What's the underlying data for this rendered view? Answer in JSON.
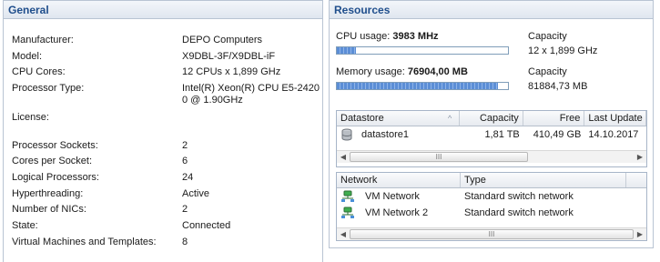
{
  "general": {
    "title": "General",
    "rows": [
      {
        "label": "Manufacturer:",
        "value": "DEPO Computers"
      },
      {
        "label": "Model:",
        "value": "X9DBL-3F/X9DBL-iF"
      },
      {
        "label": "CPU Cores:",
        "value": "12 CPUs x 1,899 GHz"
      },
      {
        "label": "Processor Type:",
        "value": "Intel(R) Xeon(R) CPU E5-2420",
        "value2": "0 @ 1.90GHz"
      },
      {
        "label": "License:",
        "value": ""
      },
      {
        "label": "Processor Sockets:",
        "value": "2"
      },
      {
        "label": "Cores per Socket:",
        "value": "6"
      },
      {
        "label": "Logical Processors:",
        "value": "24"
      },
      {
        "label": "Hyperthreading:",
        "value": "Active"
      },
      {
        "label": "Number of NICs:",
        "value": "2"
      },
      {
        "label": "State:",
        "value": "Connected"
      },
      {
        "label": "Virtual Machines and Templates:",
        "value": "8"
      }
    ]
  },
  "resources": {
    "title": "Resources",
    "cpu": {
      "label": "CPU usage:",
      "value": "3983 MHz",
      "capacity_label": "Capacity",
      "capacity": "12 x 1,899 GHz",
      "fill": 0.11
    },
    "memory": {
      "label": "Memory usage:",
      "value": "76904,00 MB",
      "capacity_label": "Capacity",
      "capacity": "81884,73 MB",
      "fill": 0.94
    },
    "datastore_table": {
      "columns": [
        "Datastore",
        "Capacity",
        "Free",
        "Last Update"
      ],
      "rows": [
        {
          "name": "datastore1",
          "capacity": "1,81 TB",
          "free": "410,49 GB",
          "last_update": "14.10.2017"
        }
      ]
    },
    "network_table": {
      "columns": [
        "Network",
        "Type"
      ],
      "rows": [
        {
          "name": "VM Network",
          "type": "Standard switch network"
        },
        {
          "name": "VM Network 2",
          "type": "Standard switch network"
        }
      ]
    }
  },
  "icons": {
    "scroll_thumb_grip": "III",
    "sort_arrow": "^"
  }
}
